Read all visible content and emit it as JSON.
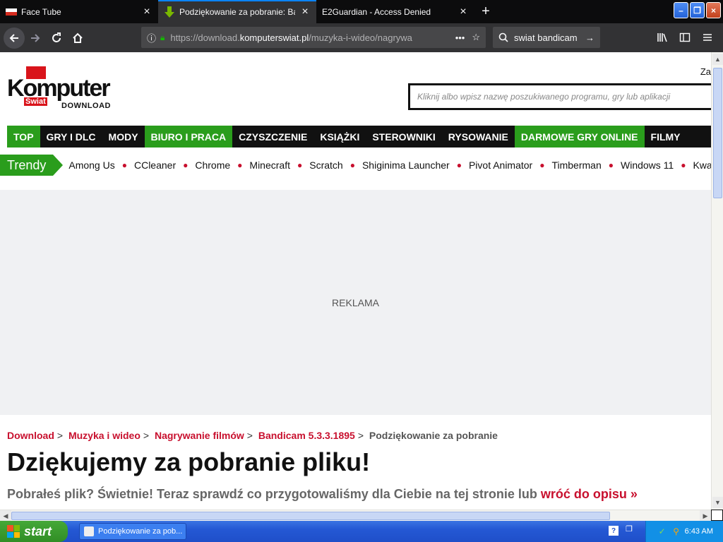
{
  "browser": {
    "tabs": [
      {
        "title": "Face Tube",
        "active": false
      },
      {
        "title": "Podziękowanie za pobranie: Bandi",
        "active": true
      },
      {
        "title": "E2Guardian - Access Denied",
        "active": false
      }
    ],
    "url_prefix": "https://download.",
    "url_domain": "komputerswiat.pl",
    "url_rest": "/muzyka-i-wideo/nagrywa",
    "search_query": "swiat bandicam"
  },
  "site": {
    "logo_text": "Komputer",
    "logo_sub": "Świat",
    "logo_download": "DOWNLOAD",
    "top_right_text": "Za",
    "search_placeholder": "Kliknij albo wpisz nazwę poszukiwanego programu, gry lub aplikacji",
    "nav": [
      {
        "label": "TOP",
        "highlight": true
      },
      {
        "label": "GRY I DLC",
        "highlight": false
      },
      {
        "label": "MODY",
        "highlight": false
      },
      {
        "label": "BIURO I PRACA",
        "highlight": true
      },
      {
        "label": "CZYSZCZENIE",
        "highlight": false
      },
      {
        "label": "KSIĄŻKI",
        "highlight": false
      },
      {
        "label": "STEROWNIKI",
        "highlight": false
      },
      {
        "label": "RYSOWANIE",
        "highlight": false
      },
      {
        "label": "DARMOWE GRY ONLINE",
        "highlight": true
      },
      {
        "label": "FILMY",
        "highlight": false
      }
    ],
    "trendy_label": "Trendy",
    "trendy": [
      "Among Us",
      "CCleaner",
      "Chrome",
      "Minecraft",
      "Scratch",
      "Shiginima Launcher",
      "Pivot Animator",
      "Timberman",
      "Windows 11",
      "Kwar"
    ],
    "ad_label": "REKLAMA",
    "breadcrumbs": [
      {
        "label": "Download",
        "link": true
      },
      {
        "label": "Muzyka i wideo",
        "link": true
      },
      {
        "label": "Nagrywanie filmów",
        "link": true
      },
      {
        "label": "Bandicam 5.3.3.1895",
        "link": true
      },
      {
        "label": "Podziękowanie za pobranie",
        "link": false
      }
    ],
    "heading": "Dziękujemy za pobranie pliku!",
    "lead_text": "Pobrałeś plik? Świetnie! Teraz sprawdź co przygotowaliśmy dla Ciebie na tej stronie lub ",
    "lead_link": "wróć do opisu »"
  },
  "taskbar": {
    "start_label": "start",
    "task_title": "Podziękowanie za pob...",
    "clock": "6:43 AM"
  },
  "colors": {
    "accent_green": "#2a9d1c",
    "accent_red": "#c8102e"
  }
}
